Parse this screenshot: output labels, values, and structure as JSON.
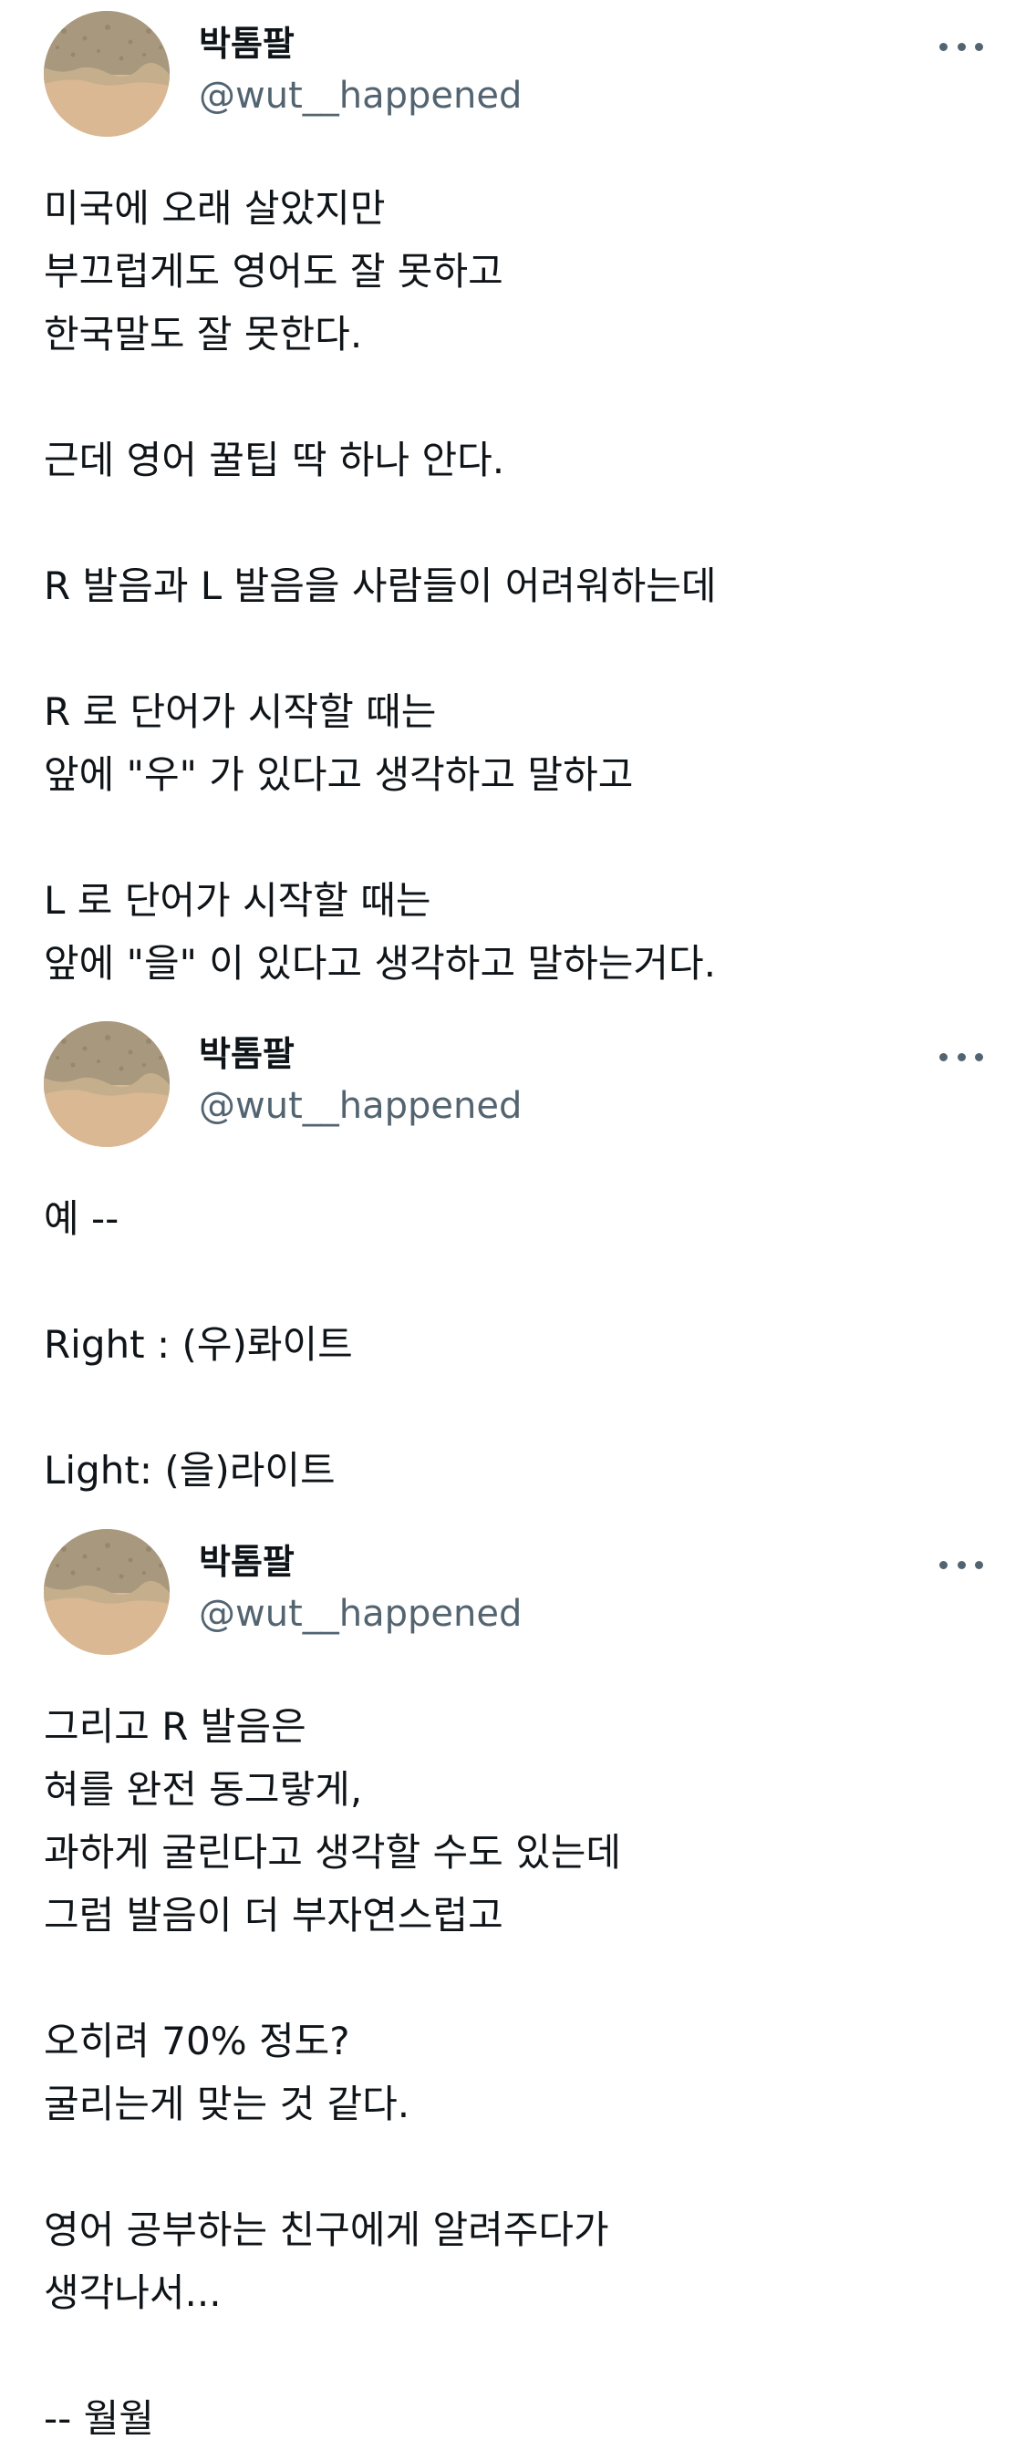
{
  "tweets": [
    {
      "display_name": "박톰팔",
      "handle": "@wut__happened",
      "lines": [
        "미국에 오래 살았지만",
        "부끄럽게도 영어도 잘 못하고",
        "한국말도 잘 못한다.",
        "",
        "근데 영어 꿀팁 딱 하나 안다.",
        "",
        "R 발음과 L 발음을 사람들이 어려워하는데",
        "",
        "R 로 단어가 시작할 때는",
        "앞에 \"우\" 가 있다고 생각하고 말하고",
        "",
        "L 로 단어가 시작할 때는",
        "앞에 \"을\" 이 있다고 생각하고 말하는거다."
      ]
    },
    {
      "display_name": "박톰팔",
      "handle": "@wut__happened",
      "lines": [
        "예 --",
        "",
        "Right : (우)롸이트",
        "",
        "Light: (을)라이트"
      ]
    },
    {
      "display_name": "박톰팔",
      "handle": "@wut__happened",
      "lines": [
        "그리고 R 발음은",
        "혀를 완전 동그랗게,",
        "과하게 굴린다고 생각할 수도 있는데",
        "그럼 발음이 더 부자연스럽고",
        "",
        "오히려 70% 정도?",
        "굴리는게 맞는 것 같다.",
        "",
        "영어 공부하는 친구에게 알려주다가",
        "생각나서...",
        "",
        "-- 월월"
      ]
    }
  ]
}
